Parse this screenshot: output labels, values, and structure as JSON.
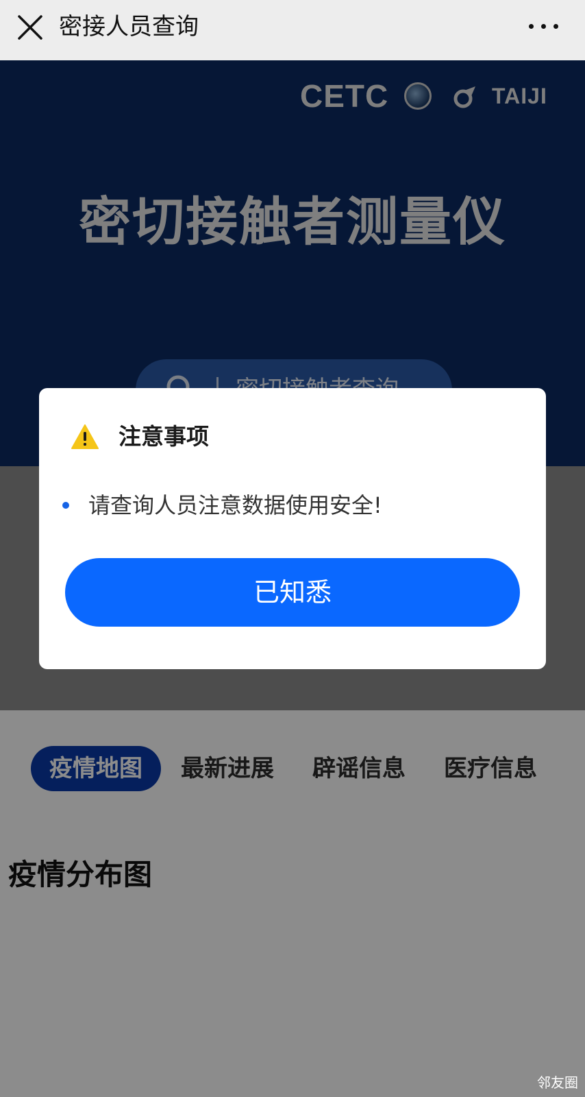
{
  "header": {
    "title": "密接人员查询"
  },
  "hero": {
    "logos": {
      "cetc": "CETC",
      "taiji": "TAIJI"
    },
    "title": "密切接触者测量仪",
    "search_placeholder": "密切接触者查询"
  },
  "tabs": [
    {
      "label": "疫情地图",
      "active": true
    },
    {
      "label": "最新进展",
      "active": false
    },
    {
      "label": "辟谣信息",
      "active": false
    },
    {
      "label": "医疗信息",
      "active": false
    }
  ],
  "section": {
    "title": "疫情分布图"
  },
  "dialog": {
    "title": "注意事项",
    "message": "请查询人员注意数据使用安全!",
    "confirm_label": "已知悉"
  },
  "watermark": "邻友圈",
  "colors": {
    "primary_button": "#0a68ff",
    "hero_background": "#0b2a63",
    "active_tab": "#0a3aa8",
    "bullet": "#1663e6",
    "warning": "#f5c518"
  }
}
